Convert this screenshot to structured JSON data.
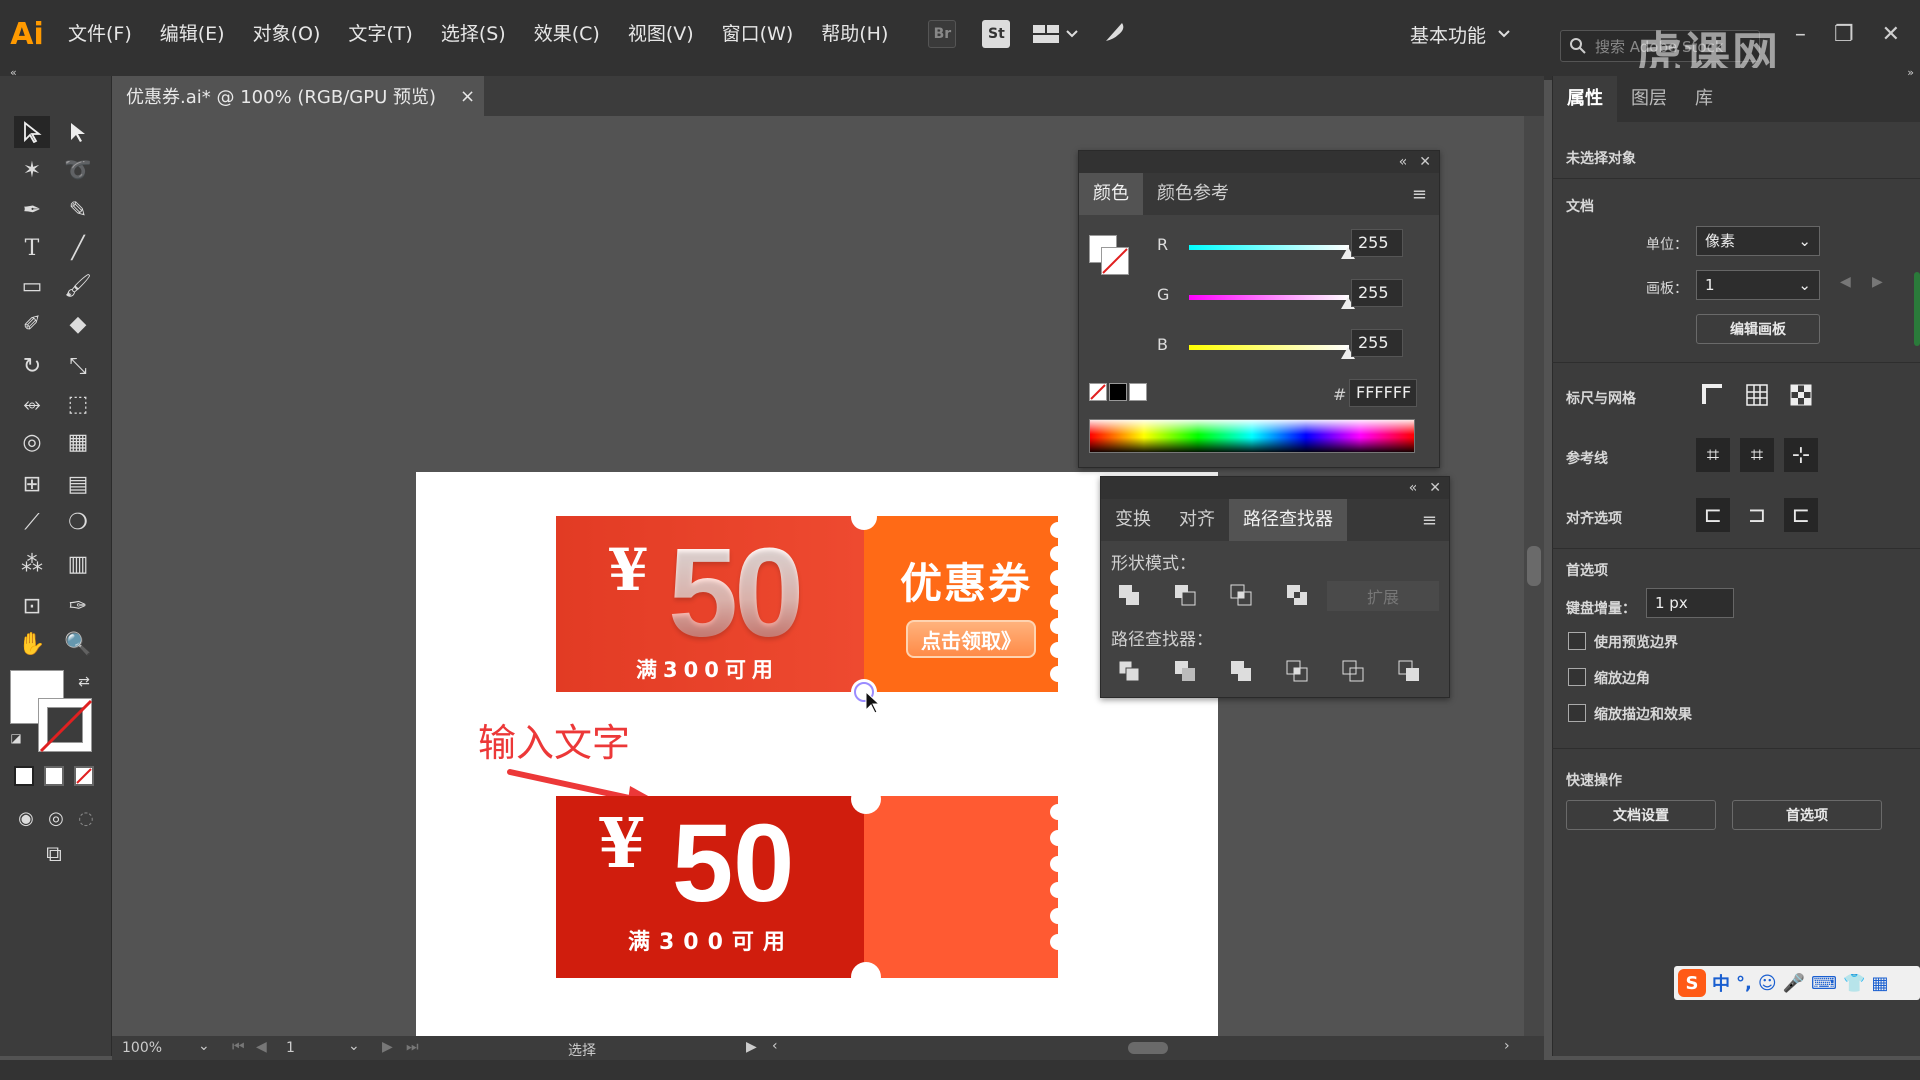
{
  "app": {
    "logo": "Ai",
    "menu": [
      "文件(F)",
      "编辑(E)",
      "对象(O)",
      "文字(T)",
      "选择(S)",
      "效果(C)",
      "视图(V)",
      "窗口(W)",
      "帮助(H)"
    ],
    "br_label": "Br",
    "st_label": "St",
    "workspace": "基本功能",
    "search_placeholder": "搜索 Adobe Stock",
    "watermark": "虎课网"
  },
  "document": {
    "tab_title": "优惠券.ai* @ 100% (RGB/GPU 预览)",
    "close": "×"
  },
  "coupon1": {
    "currency": "¥",
    "amount": "50",
    "condition": "满300可用",
    "title": "优惠券",
    "button": "点击领取》"
  },
  "coupon2": {
    "currency": "¥",
    "amount": "50",
    "condition": "满300可用"
  },
  "annotation": {
    "text": "输入文字",
    "color": "#ec3838"
  },
  "color_panel": {
    "tabs": [
      "颜色",
      "颜色参考"
    ],
    "r_label": "R",
    "r_value": "255",
    "g_label": "G",
    "g_value": "255",
    "b_label": "B",
    "b_value": "255",
    "hex_label": "#",
    "hex_value": "FFFFFF"
  },
  "pathfinder_panel": {
    "tabs": [
      "变换",
      "对齐",
      "路径查找器"
    ],
    "shape_modes_label": "形状模式：",
    "expand_label": "扩展",
    "pathfinders_label": "路径查找器："
  },
  "properties": {
    "tabs": [
      "属性",
      "图层",
      "库"
    ],
    "no_selection": "未选择对象",
    "document_section": "文档",
    "unit_label": "单位：",
    "unit_value": "像素",
    "artboard_label": "画板：",
    "artboard_value": "1",
    "edit_artboard": "编辑画板",
    "rulers_grid": "标尺与网格",
    "guides": "参考线",
    "align_options": "对齐选项",
    "preferences": "首选项",
    "keyboard_increment_label": "键盘增量：",
    "keyboard_increment_value": "1 px",
    "use_preview_bounds": "使用预览边界",
    "scale_corners": "缩放边角",
    "scale_strokes": "缩放描边和效果",
    "quick_actions": "快速操作",
    "doc_setup_button": "文档设置",
    "prefs_button": "首选项"
  },
  "statusbar": {
    "zoom": "100%",
    "artboard_nav": "1",
    "tool": "选择"
  },
  "ime": {
    "label": "中"
  }
}
